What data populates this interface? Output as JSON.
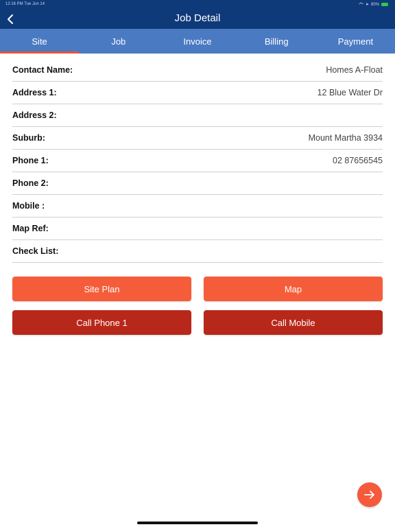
{
  "status_bar": {
    "time": "12:16 PM   Tue Jun 14",
    "battery": "80%"
  },
  "nav": {
    "title": "Job Detail",
    "back_icon": "chevron-left-icon"
  },
  "tabs": [
    {
      "label": "Site",
      "active": true
    },
    {
      "label": "Job",
      "active": false
    },
    {
      "label": "Invoice",
      "active": false
    },
    {
      "label": "Billing",
      "active": false
    },
    {
      "label": "Payment",
      "active": false
    }
  ],
  "fields": [
    {
      "label": "Contact Name:",
      "value": "Homes A-Float"
    },
    {
      "label": "Address 1:",
      "value": "12 Blue Water Dr"
    },
    {
      "label": "Address 2:",
      "value": ""
    },
    {
      "label": "Suburb:",
      "value": "Mount Martha 3934"
    },
    {
      "label": "Phone 1:",
      "value": "02 87656545"
    },
    {
      "label": "Phone 2:",
      "value": ""
    },
    {
      "label": "Mobile :",
      "value": ""
    },
    {
      "label": "Map Ref:",
      "value": ""
    },
    {
      "label": "Check List:",
      "value": ""
    }
  ],
  "buttons": {
    "site_plan": "Site Plan",
    "map": "Map",
    "call_phone1": "Call Phone 1",
    "call_mobile": "Call Mobile"
  },
  "fab_icon": "arrow-right-icon",
  "colors": {
    "nav_bg": "#0f3a7a",
    "tab_bg": "#4a7ac2",
    "tab_indicator": "#e8543a",
    "primary_button": "#f55d3a",
    "secondary_button": "#b8281a"
  }
}
